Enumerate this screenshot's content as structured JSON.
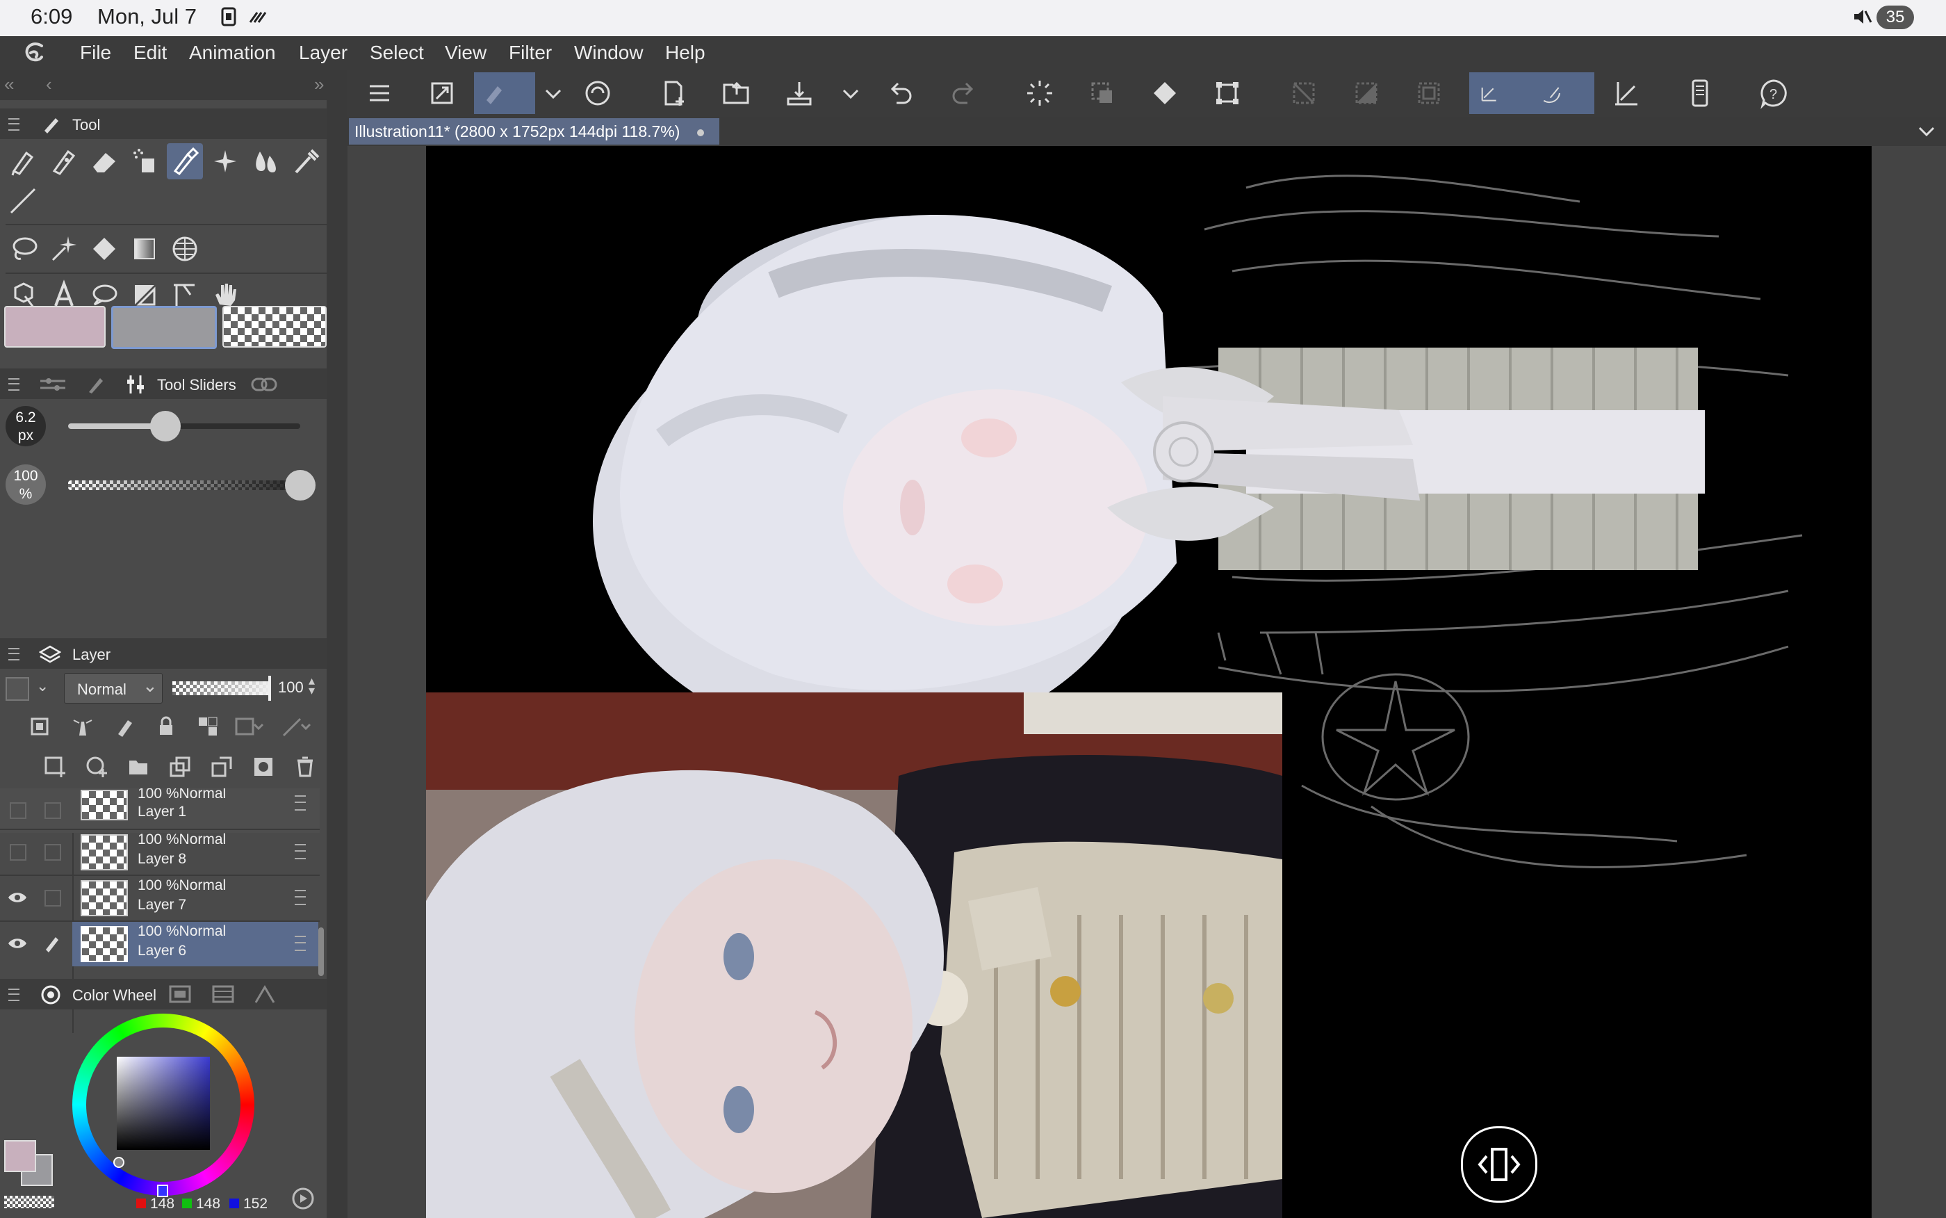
{
  "status_bar": {
    "time": "6:09",
    "date": "Mon, Jul 7",
    "battery": "35"
  },
  "menu": [
    "File",
    "Edit",
    "Animation",
    "Layer",
    "Select",
    "View",
    "Filter",
    "Window",
    "Help"
  ],
  "tool_panel": {
    "title": "Tool",
    "tools_row1": [
      "pen-icon",
      "pencil-icon",
      "eraser-icon",
      "spray-icon",
      "brush-icon",
      "sparkle-icon",
      "blend-icon",
      "eyedropper-icon"
    ],
    "tools_row2": [
      "line-icon"
    ],
    "tools_row3": [
      "lasso-icon",
      "magic-wand-icon",
      "fill-icon",
      "gradient-icon",
      "mesh-icon"
    ],
    "tools_row4": [
      "operation-icon",
      "text-icon",
      "balloon-icon",
      "frame-icon",
      "ruler-icon",
      "hand-icon"
    ],
    "colors": {
      "main": "#c8b0bd",
      "sub": "#9a9a9e"
    }
  },
  "tool_sliders": {
    "title": "Tool Sliders",
    "size": {
      "value": "6.2",
      "unit": "px",
      "fraction": 0.42
    },
    "opacity": {
      "value": "100",
      "unit": "%",
      "fraction": 1.0
    }
  },
  "layer_panel": {
    "title": "Layer",
    "blend_mode": "Normal",
    "opacity": "100",
    "layers": [
      {
        "opacity_mode": "100 %Normal",
        "name": "Layer 1",
        "visible": false,
        "selected": false
      },
      {
        "opacity_mode": "100 %Normal",
        "name": "Layer 8",
        "visible": false,
        "selected": false
      },
      {
        "opacity_mode": "100 %Normal",
        "name": "Layer 7",
        "visible": true,
        "selected": false
      },
      {
        "opacity_mode": "100 %Normal",
        "name": "Layer 6",
        "visible": true,
        "selected": true
      }
    ]
  },
  "color_wheel": {
    "title": "Color Wheel",
    "r": "148",
    "g": "148",
    "b": "152",
    "hue_color": "#3a3ad0"
  },
  "document_tab": {
    "title": "Illustration11* (2800 x 1752px 144dpi 118.7%)"
  }
}
